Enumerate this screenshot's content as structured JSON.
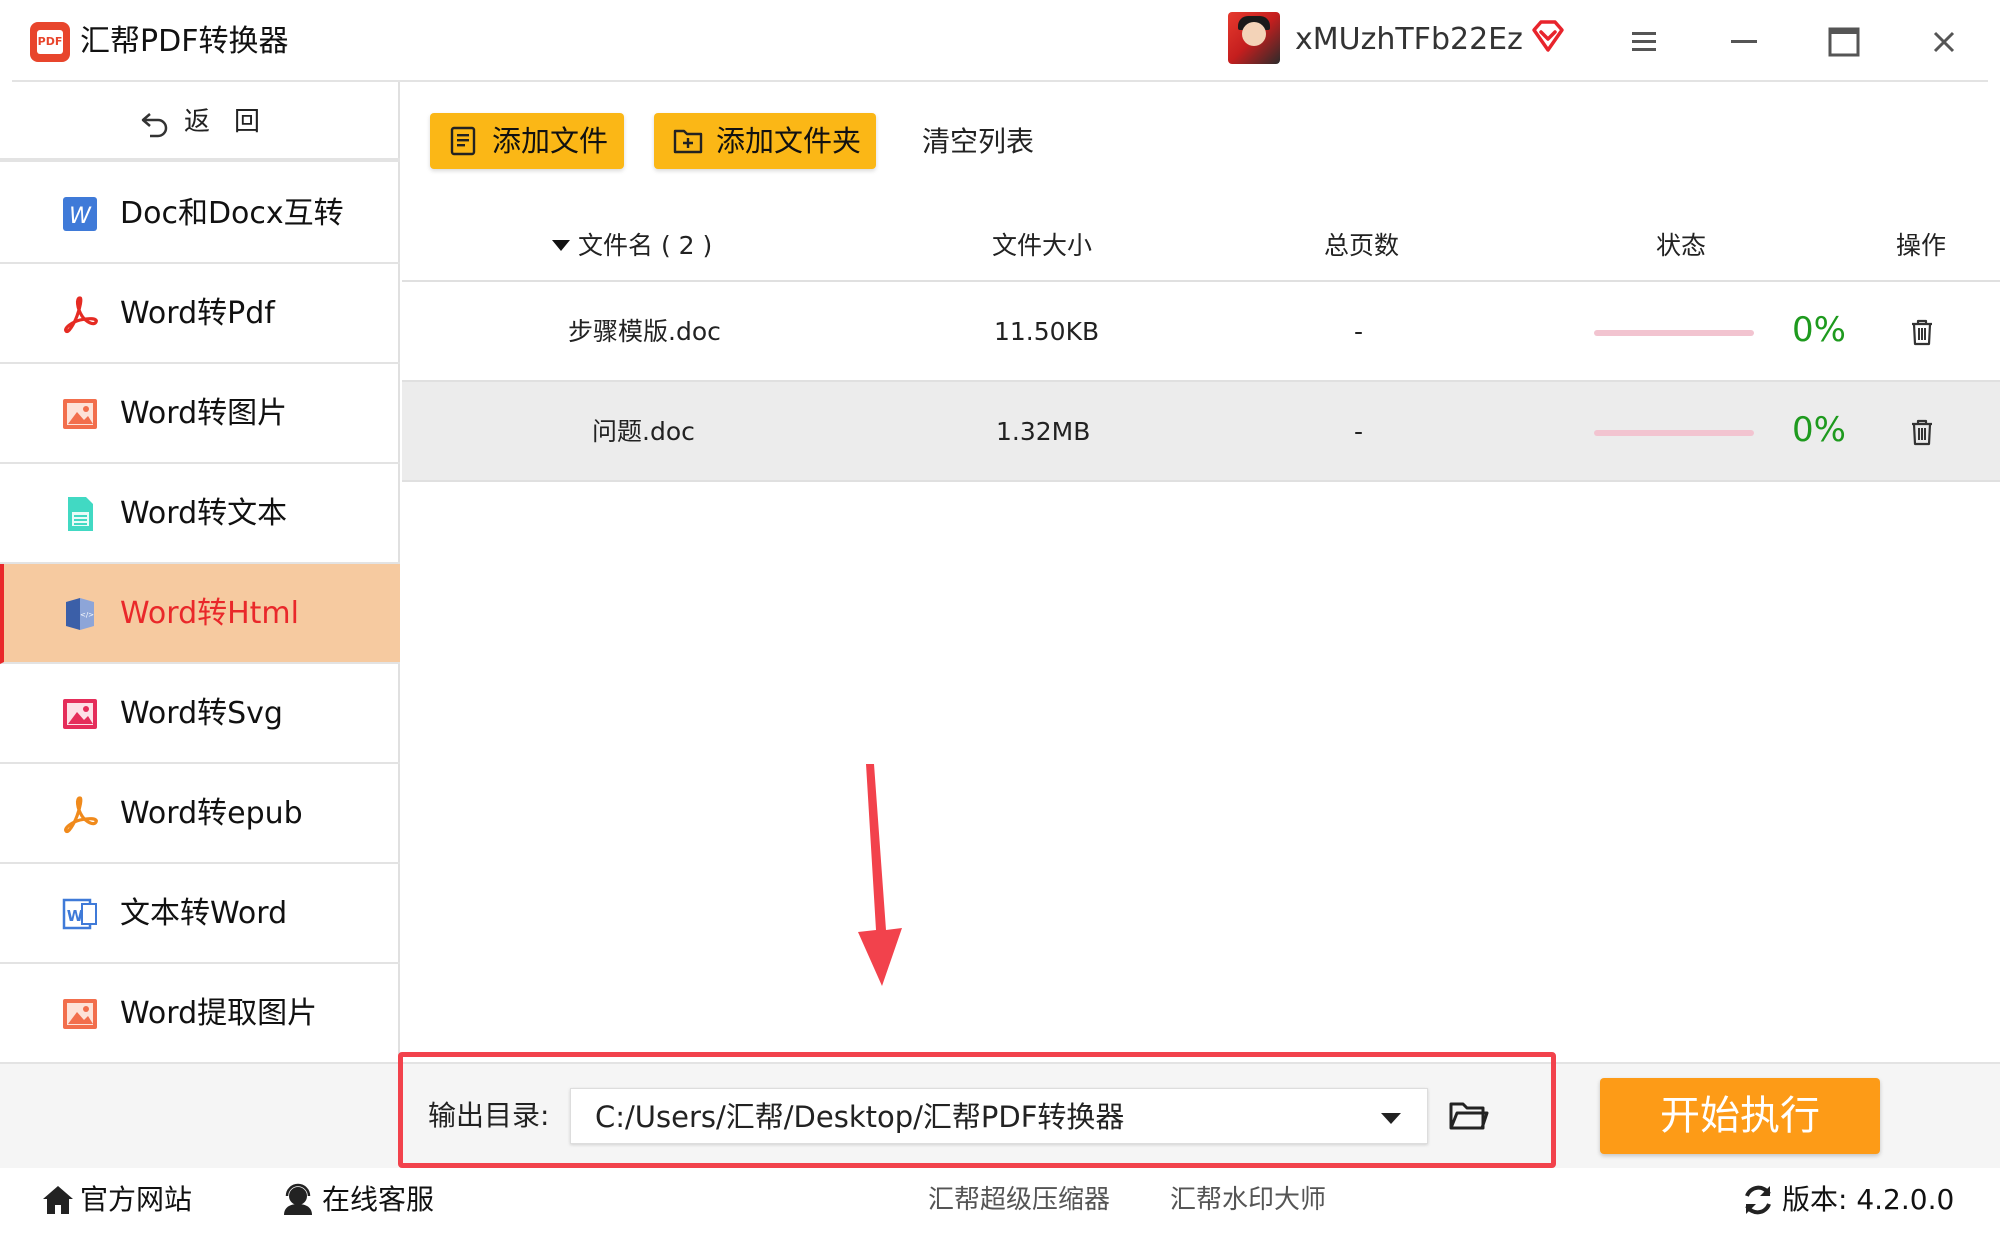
{
  "app": {
    "title": "汇帮PDF转换器",
    "logo_text": "PDF",
    "username": "xMUzhTFb22Ez"
  },
  "colors": {
    "accent_yellow": "#fbb716",
    "start_orange": "#fd9b17",
    "active_bg": "#f6caa0",
    "active_text": "#e9282a",
    "percent_green": "#1e9a1e",
    "annotation_red": "#f2424c"
  },
  "sidebar": {
    "back_label": "返回",
    "items": [
      {
        "label": "Doc和Docx互转",
        "icon": "word-w-icon",
        "active": false
      },
      {
        "label": "Word转Pdf",
        "icon": "pdf-acrobat-icon",
        "active": false
      },
      {
        "label": "Word转图片",
        "icon": "image-icon",
        "active": false
      },
      {
        "label": "Word转文本",
        "icon": "text-doc-icon",
        "active": false
      },
      {
        "label": "Word转Html",
        "icon": "html-book-icon",
        "active": true
      },
      {
        "label": "Word转Svg",
        "icon": "svg-image-icon",
        "active": false
      },
      {
        "label": "Word转epub",
        "icon": "epub-acrobat-icon",
        "active": false
      },
      {
        "label": "文本转Word",
        "icon": "word-doc-icon",
        "active": false
      },
      {
        "label": "Word提取图片",
        "icon": "extract-image-icon",
        "active": false
      }
    ]
  },
  "toolbar": {
    "add_file": "添加文件",
    "add_folder": "添加文件夹",
    "clear_list": "清空列表"
  },
  "table": {
    "headers": {
      "filename": "文件名 ( 2 )",
      "size": "文件大小",
      "pages": "总页数",
      "status": "状态",
      "action": "操作"
    },
    "rows": [
      {
        "name": "步骤模版.doc",
        "size": "11.50KB",
        "pages": "-",
        "progress": 0,
        "percent": "0%"
      },
      {
        "name": "问题.doc",
        "size": "1.32MB",
        "pages": "-",
        "progress": 0,
        "percent": "0%"
      }
    ]
  },
  "output": {
    "label": "输出目录:",
    "path": "C:/Users/汇帮/Desktop/汇帮PDF转换器",
    "start_button": "开始执行"
  },
  "footer": {
    "official_site": "官方网站",
    "online_service": "在线客服",
    "compressor": "汇帮超级压缩器",
    "watermark": "汇帮水印大师",
    "version": "版本: 4.2.0.0"
  }
}
